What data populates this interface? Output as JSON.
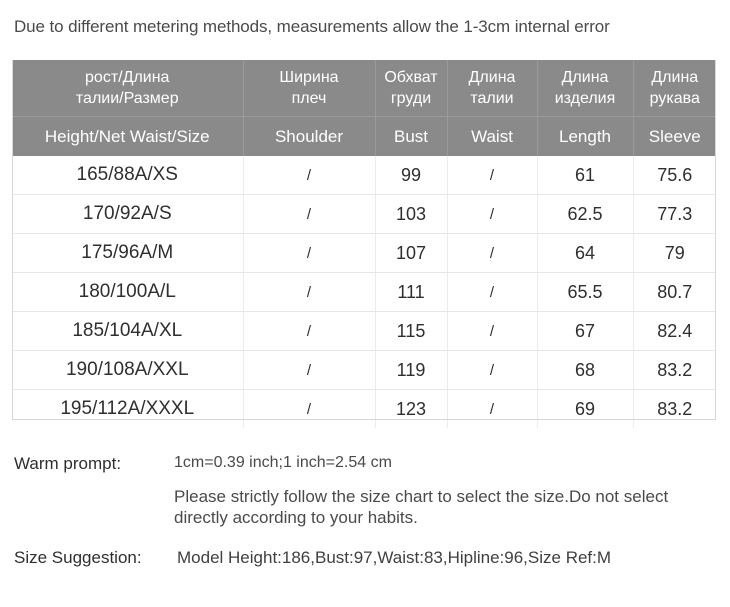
{
  "notice": "Due to different metering methods, measurements allow the 1-3cm internal error",
  "table": {
    "headers_ru": [
      "рост/Длина\nталии/Размер",
      "Ширина\nплеч",
      "Обхват\nгруди",
      "Длина\nталии",
      "Длина\nизделия",
      "Длина\nрукава"
    ],
    "headers_ru_lines": [
      [
        "рост/Длина",
        "талии/Размер"
      ],
      [
        "Ширина",
        "плеч"
      ],
      [
        "Обхват",
        "груди"
      ],
      [
        "Длина",
        "талии"
      ],
      [
        "Длина",
        "изделия"
      ],
      [
        "Длина",
        "рукава"
      ]
    ],
    "headers_en": [
      "Height/Net  Waist/Size",
      "Shoulder",
      "Bust",
      "Waist",
      "Length",
      "Sleeve"
    ],
    "rows": [
      {
        "size": "165/88A/XS",
        "shoulder": "/",
        "bust": "99",
        "waist": "/",
        "length": "61",
        "sleeve": "75.6"
      },
      {
        "size": "170/92A/S",
        "shoulder": "/",
        "bust": "103",
        "waist": "/",
        "length": "62.5",
        "sleeve": "77.3"
      },
      {
        "size": "175/96A/M",
        "shoulder": "/",
        "bust": "107",
        "waist": "/",
        "length": "64",
        "sleeve": "79"
      },
      {
        "size": "180/100A/L",
        "shoulder": "/",
        "bust": "111",
        "waist": "/",
        "length": "65.5",
        "sleeve": "80.7"
      },
      {
        "size": "185/104A/XL",
        "shoulder": "/",
        "bust": "115",
        "waist": "/",
        "length": "67",
        "sleeve": "82.4"
      },
      {
        "size": "190/108A/XXL",
        "shoulder": "/",
        "bust": "119",
        "waist": "/",
        "length": "68",
        "sleeve": "83.2"
      },
      {
        "size": "195/112A/XXXL",
        "shoulder": "/",
        "bust": "123",
        "waist": "/",
        "length": "69",
        "sleeve": "83.2"
      }
    ],
    "header_bg": "#8a8a8a",
    "header_text_color": "#ffffff"
  },
  "footer": {
    "warm_prompt_label": "Warm prompt:",
    "conversion": "1cm=0.39 inch;1 inch=2.54 cm",
    "note": "Please strictly follow the size chart  to select the size.Do not select directly according to your habits.",
    "size_suggestion_label": "Size Suggestion:",
    "size_suggestion_value": "Model Height:186,Bust:97,Waist:83,Hipline:96,Size Ref:M"
  }
}
